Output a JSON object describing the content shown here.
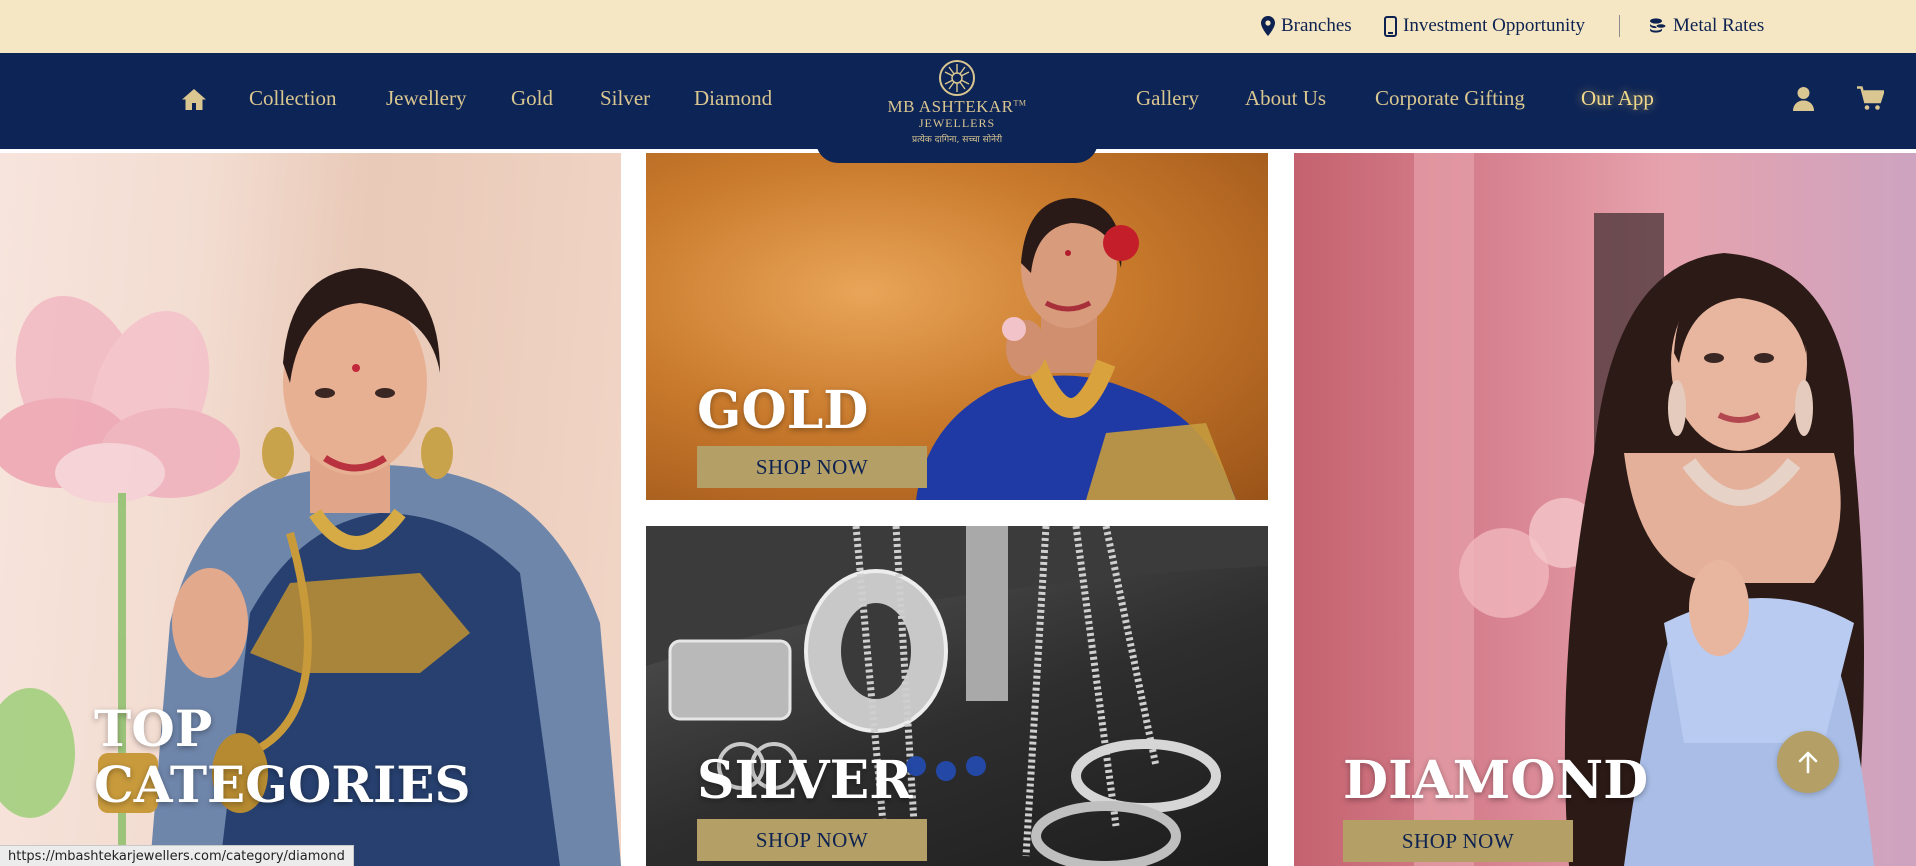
{
  "topbar": {
    "branches": "Branches",
    "investment": "Investment Opportunity",
    "metal_rates": "Metal Rates"
  },
  "nav": {
    "left": [
      "Collection",
      "Jewellery",
      "Gold",
      "Silver",
      "Diamond"
    ],
    "right": [
      "Gallery",
      "About Us",
      "Corporate Gifting",
      "Our App"
    ]
  },
  "logo": {
    "name": "MB ASHTEKAR",
    "trademark": "TM",
    "sub": "JEWELLERS",
    "tagline": "प्रत्येक दागिना, सच्चा सोनेरी"
  },
  "tiles": {
    "top_categories": {
      "line1": "TOP",
      "line2": "CATEGORIES"
    },
    "gold": {
      "title": "GOLD",
      "button": "SHOP NOW"
    },
    "silver": {
      "title": "SILVER",
      "button": "SHOP NOW"
    },
    "diamond": {
      "title": "DIAMOND",
      "button": "SHOP NOW"
    }
  },
  "status_url": "https://mbashtekarjewellers.com/category/diamond",
  "colors": {
    "navy": "#0d2456",
    "gold_text": "#d9c690",
    "cream": "#f5e7c4",
    "button_gold": "#b4a066"
  }
}
